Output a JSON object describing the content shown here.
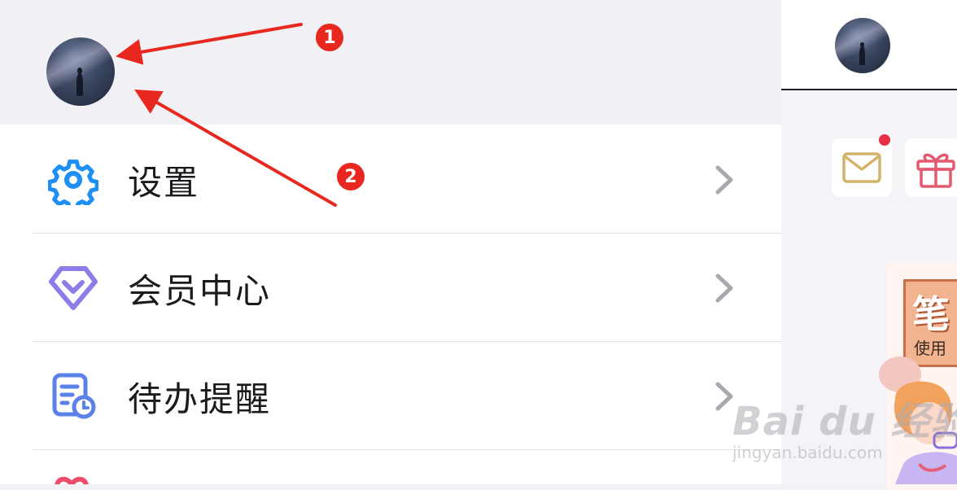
{
  "drawer": {
    "menu": [
      {
        "label": "设置",
        "icon": "gear-icon",
        "icon_color": "#1e8ff5"
      },
      {
        "label": "会员中心",
        "icon": "diamond-icon",
        "icon_color": "#8f7ce6"
      },
      {
        "label": "待办提醒",
        "icon": "todo-list-icon",
        "icon_color": "#5b82e8"
      }
    ]
  },
  "annotations": {
    "badge_1": "1",
    "badge_2": "2",
    "color": "#e8281e"
  },
  "right_panel": {
    "banner_title": "笔",
    "banner_subtitle": "使用"
  },
  "watermark": {
    "main": "Bai du 经验",
    "sub": "jingyan.baidu.com"
  }
}
